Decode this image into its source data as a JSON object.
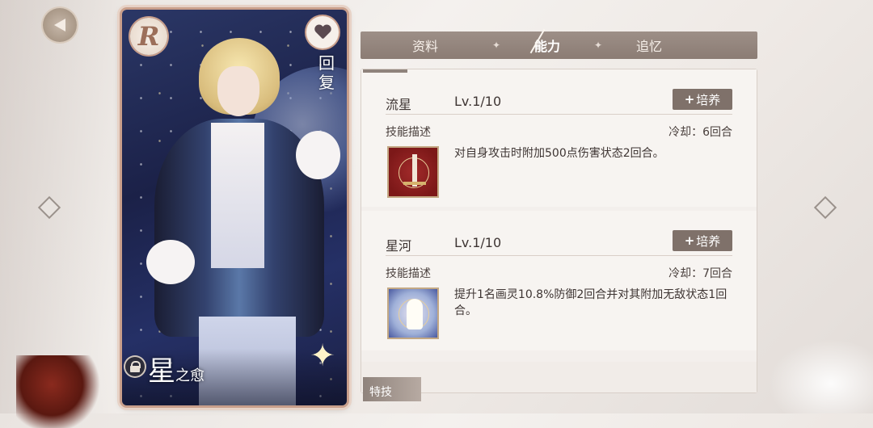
{
  "card": {
    "rarity": "R",
    "type_icon": "heart-pulse-icon",
    "type_label": "回复",
    "name_big": "星",
    "name_small": "之愈"
  },
  "tabs": [
    {
      "label": "资料",
      "active": false
    },
    {
      "label": "能力",
      "active": true
    },
    {
      "label": "追忆",
      "active": false
    }
  ],
  "tab_separator": "✦",
  "skills": [
    {
      "name": "流星",
      "level": "Lv.1/10",
      "train_label": "培养",
      "desc_label": "技能描述",
      "cooldown": "冷却：6回合",
      "description": "对自身攻击时附加500点伤害状态2回合。",
      "icon": "sword-icon"
    },
    {
      "name": "星河",
      "level": "Lv.1/10",
      "train_label": "培养",
      "desc_label": "技能描述",
      "cooldown": "冷却：7回合",
      "description": "提升1名画灵10.8%防御2回合并对其附加无敌状态1回合。",
      "icon": "angel-icon"
    }
  ],
  "trait_tab": "特技",
  "colors": {
    "accent": "#7f716a",
    "tab_bar": "#9d8f87",
    "card_frame": "#c99f8b"
  }
}
